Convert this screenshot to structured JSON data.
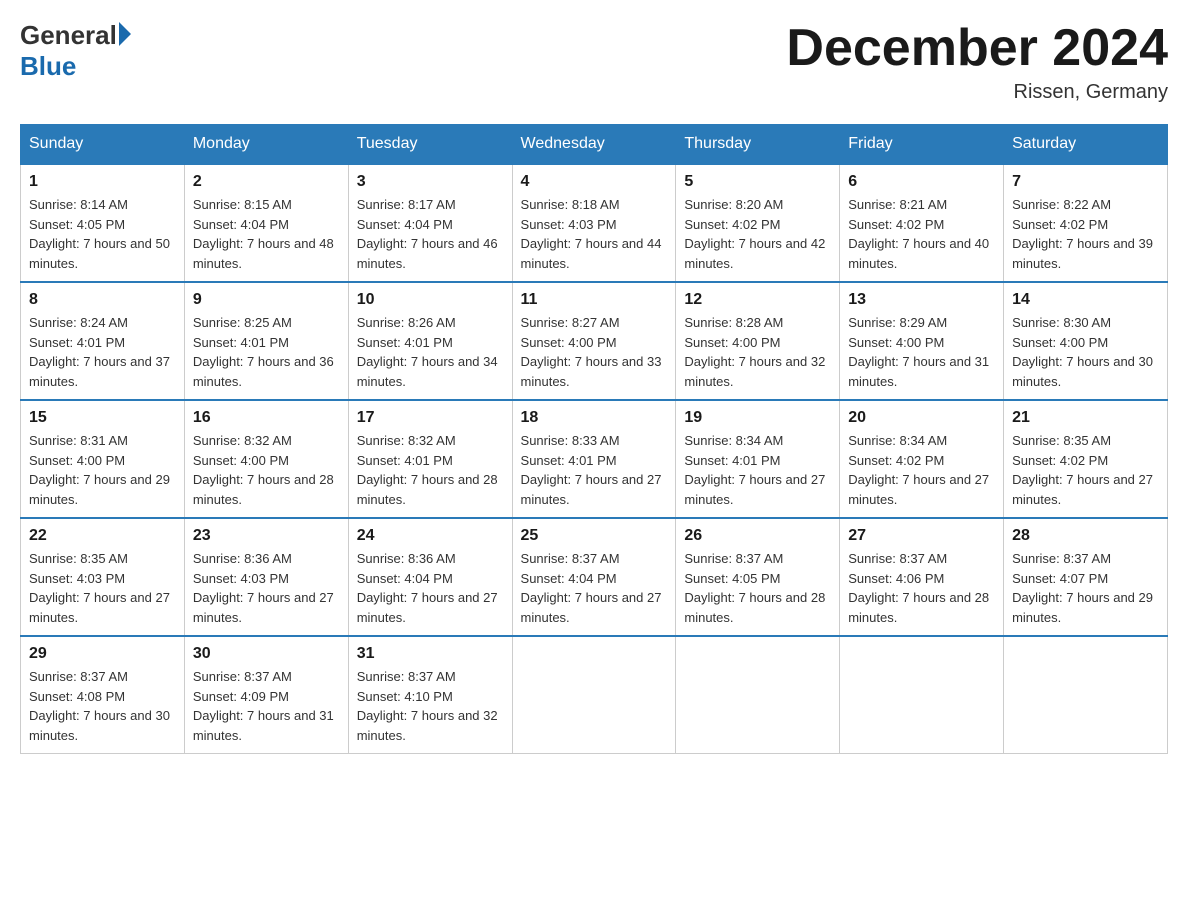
{
  "header": {
    "logo": {
      "general": "General",
      "blue": "Blue"
    },
    "title": "December 2024",
    "location": "Rissen, Germany"
  },
  "calendar": {
    "weekdays": [
      "Sunday",
      "Monday",
      "Tuesday",
      "Wednesday",
      "Thursday",
      "Friday",
      "Saturday"
    ],
    "weeks": [
      [
        {
          "day": 1,
          "sunrise": "8:14 AM",
          "sunset": "4:05 PM",
          "daylight": "7 hours and 50 minutes."
        },
        {
          "day": 2,
          "sunrise": "8:15 AM",
          "sunset": "4:04 PM",
          "daylight": "7 hours and 48 minutes."
        },
        {
          "day": 3,
          "sunrise": "8:17 AM",
          "sunset": "4:04 PM",
          "daylight": "7 hours and 46 minutes."
        },
        {
          "day": 4,
          "sunrise": "8:18 AM",
          "sunset": "4:03 PM",
          "daylight": "7 hours and 44 minutes."
        },
        {
          "day": 5,
          "sunrise": "8:20 AM",
          "sunset": "4:02 PM",
          "daylight": "7 hours and 42 minutes."
        },
        {
          "day": 6,
          "sunrise": "8:21 AM",
          "sunset": "4:02 PM",
          "daylight": "7 hours and 40 minutes."
        },
        {
          "day": 7,
          "sunrise": "8:22 AM",
          "sunset": "4:02 PM",
          "daylight": "7 hours and 39 minutes."
        }
      ],
      [
        {
          "day": 8,
          "sunrise": "8:24 AM",
          "sunset": "4:01 PM",
          "daylight": "7 hours and 37 minutes."
        },
        {
          "day": 9,
          "sunrise": "8:25 AM",
          "sunset": "4:01 PM",
          "daylight": "7 hours and 36 minutes."
        },
        {
          "day": 10,
          "sunrise": "8:26 AM",
          "sunset": "4:01 PM",
          "daylight": "7 hours and 34 minutes."
        },
        {
          "day": 11,
          "sunrise": "8:27 AM",
          "sunset": "4:00 PM",
          "daylight": "7 hours and 33 minutes."
        },
        {
          "day": 12,
          "sunrise": "8:28 AM",
          "sunset": "4:00 PM",
          "daylight": "7 hours and 32 minutes."
        },
        {
          "day": 13,
          "sunrise": "8:29 AM",
          "sunset": "4:00 PM",
          "daylight": "7 hours and 31 minutes."
        },
        {
          "day": 14,
          "sunrise": "8:30 AM",
          "sunset": "4:00 PM",
          "daylight": "7 hours and 30 minutes."
        }
      ],
      [
        {
          "day": 15,
          "sunrise": "8:31 AM",
          "sunset": "4:00 PM",
          "daylight": "7 hours and 29 minutes."
        },
        {
          "day": 16,
          "sunrise": "8:32 AM",
          "sunset": "4:00 PM",
          "daylight": "7 hours and 28 minutes."
        },
        {
          "day": 17,
          "sunrise": "8:32 AM",
          "sunset": "4:01 PM",
          "daylight": "7 hours and 28 minutes."
        },
        {
          "day": 18,
          "sunrise": "8:33 AM",
          "sunset": "4:01 PM",
          "daylight": "7 hours and 27 minutes."
        },
        {
          "day": 19,
          "sunrise": "8:34 AM",
          "sunset": "4:01 PM",
          "daylight": "7 hours and 27 minutes."
        },
        {
          "day": 20,
          "sunrise": "8:34 AM",
          "sunset": "4:02 PM",
          "daylight": "7 hours and 27 minutes."
        },
        {
          "day": 21,
          "sunrise": "8:35 AM",
          "sunset": "4:02 PM",
          "daylight": "7 hours and 27 minutes."
        }
      ],
      [
        {
          "day": 22,
          "sunrise": "8:35 AM",
          "sunset": "4:03 PM",
          "daylight": "7 hours and 27 minutes."
        },
        {
          "day": 23,
          "sunrise": "8:36 AM",
          "sunset": "4:03 PM",
          "daylight": "7 hours and 27 minutes."
        },
        {
          "day": 24,
          "sunrise": "8:36 AM",
          "sunset": "4:04 PM",
          "daylight": "7 hours and 27 minutes."
        },
        {
          "day": 25,
          "sunrise": "8:37 AM",
          "sunset": "4:04 PM",
          "daylight": "7 hours and 27 minutes."
        },
        {
          "day": 26,
          "sunrise": "8:37 AM",
          "sunset": "4:05 PM",
          "daylight": "7 hours and 28 minutes."
        },
        {
          "day": 27,
          "sunrise": "8:37 AM",
          "sunset": "4:06 PM",
          "daylight": "7 hours and 28 minutes."
        },
        {
          "day": 28,
          "sunrise": "8:37 AM",
          "sunset": "4:07 PM",
          "daylight": "7 hours and 29 minutes."
        }
      ],
      [
        {
          "day": 29,
          "sunrise": "8:37 AM",
          "sunset": "4:08 PM",
          "daylight": "7 hours and 30 minutes."
        },
        {
          "day": 30,
          "sunrise": "8:37 AM",
          "sunset": "4:09 PM",
          "daylight": "7 hours and 31 minutes."
        },
        {
          "day": 31,
          "sunrise": "8:37 AM",
          "sunset": "4:10 PM",
          "daylight": "7 hours and 32 minutes."
        },
        null,
        null,
        null,
        null
      ]
    ]
  }
}
